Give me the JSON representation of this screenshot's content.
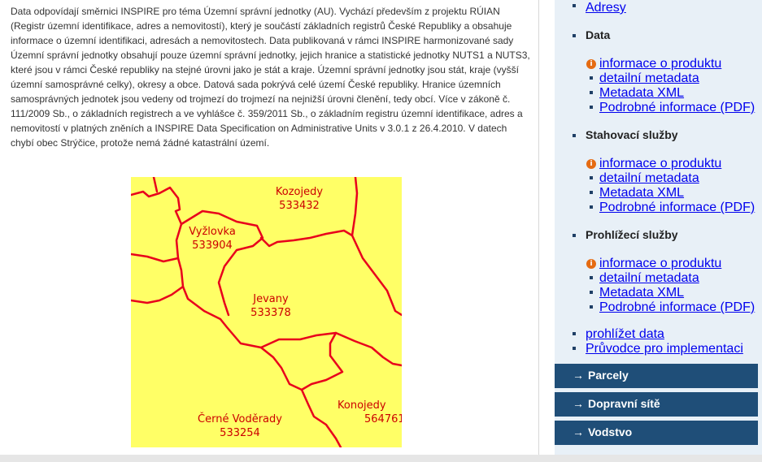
{
  "description": "Data odpovídají směrnici INSPIRE pro téma Územní správní jednotky (AU). Vychází především z projektu RÚIAN (Registr územní identifikace, adres a nemovitostí), který je součástí základních registrů České Republiky a obsahuje informace o územní identifikaci, adresách a nemovitostech. Data publikovaná v rámci INSPIRE harmonizované sady Územní správní jednotky obsahují pouze územní správní jednotky, jejich hranice a statistické jednotky NUTS1 a NUTS3, které jsou v rámci České republiky na stejné úrovni jako je stát a kraje. Územní správní jednotky jsou stát, kraje (vyšší územní samosprávné celky), okresy a obce. Datová sada pokrývá celé území České republiky. Hranice územních samosprávných jednotek jsou vedeny od trojmezí do trojmezí na nejnižší úrovni členění, tedy obcí. Více v zákoně č. 111/2009 Sb., o základních registrech a ve vyhlášce č. 359/2011 Sb., o základním registru územní identifikace, adres a nemovitostí v platných zněních a INSPIRE Data Specification on Administrative Units v 3.0.1 z 26.4.2010. V datech chybí obec Strýčice, protože nemá žádné katastrální území.",
  "map": {
    "fill_color": "#ffff66",
    "border_color": "#e8001c",
    "labels": [
      {
        "name": "Kozojedy",
        "code": "533432"
      },
      {
        "name": "Vyžlovka",
        "code": "533904"
      },
      {
        "name": "Jevany",
        "code": "533378"
      },
      {
        "name": "Černé Voděrady",
        "code": "533254"
      },
      {
        "name": "Konojedy",
        "code": "564761"
      }
    ]
  },
  "sidebar": {
    "top_link": "Adresy",
    "sections": [
      {
        "title": "Data",
        "info_link": "informace o produktu",
        "links": [
          "detailní metadata",
          "Metadata XML",
          "Podrobné informace (PDF)"
        ]
      },
      {
        "title": "Stahovací služby",
        "info_link": "informace o produktu",
        "links": [
          "detailní metadata",
          "Metadata XML",
          "Podrobné informace (PDF)"
        ]
      },
      {
        "title": "Prohlížecí služby",
        "info_link": "informace o produktu",
        "links": [
          "detailní metadata",
          "Metadata XML",
          "Podrobné informace (PDF)"
        ]
      }
    ],
    "extra_links": [
      "prohlížet data",
      "Průvodce pro implementaci"
    ],
    "nav_buttons": [
      "Parcely",
      "Dopravní sítě",
      "Vodstvo"
    ],
    "nav_arrow": "→",
    "info_glyph": "i"
  },
  "colors": {
    "link": "#1f4e8a",
    "nav_bar": "#1f4e78",
    "sidebar_bg": "#e8f0f7",
    "info_icon": "#e56b12"
  }
}
